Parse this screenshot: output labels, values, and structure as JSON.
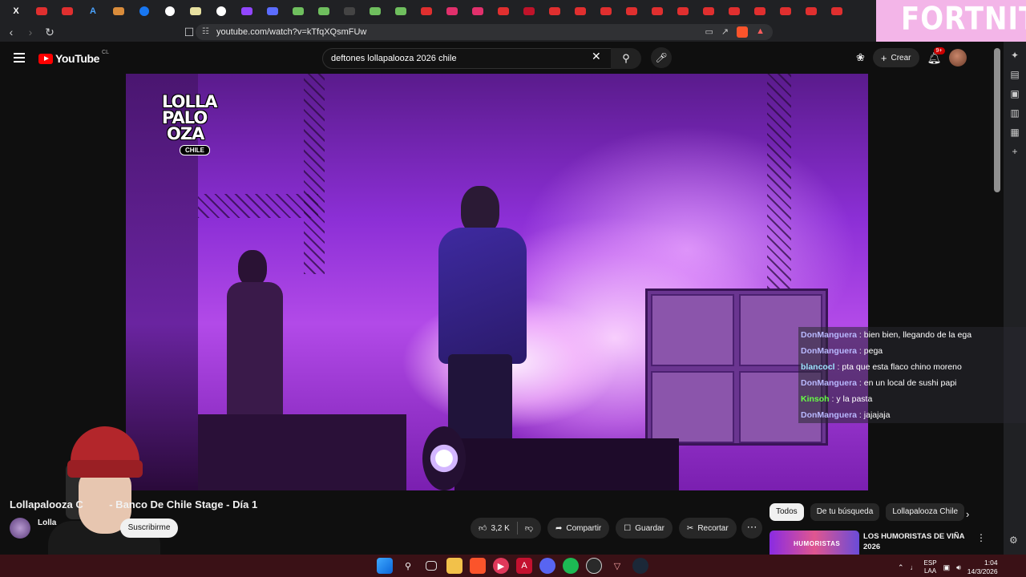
{
  "browser": {
    "url": "youtube.com/watch?v=kTfqXQsmFUw",
    "active_tab_banner": "FORTNITE"
  },
  "youtube": {
    "logo_text": "YouTube",
    "region": "CL",
    "search_query": "deftones lollapalooza 2026 chile",
    "create_label": "Crear",
    "notifications_badge": "9+"
  },
  "video": {
    "logo_lines": [
      "LOLLA",
      "PALO",
      "OZA"
    ],
    "logo_chile": "CHILE",
    "title": "Lollapalooza Chile 2026 - Banco De Chile Stage - Día 1",
    "title_visible": "Lollapalooza C         - Banco De Chile Stage - Día 1",
    "channel": "Lollapalooza Chile",
    "channel_visible": "Lolla",
    "subscribe_label": "Suscribirme",
    "likes": "3,2 K",
    "share_label": "Compartir",
    "save_label": "Guardar",
    "clip_label": "Recortar"
  },
  "chat": [
    {
      "user": "DonManguera",
      "message": "bien bien, llegando de la ega",
      "color": "#b9b9ff"
    },
    {
      "user": "DonManguera",
      "message": "pega",
      "color": "#b9b9ff"
    },
    {
      "user": "blancocl",
      "message": "pta que esta flaco chino moreno",
      "color": "#9fe6ff"
    },
    {
      "user": "DonManguera",
      "message": "en un local de sushi papi",
      "color": "#b9b9ff"
    },
    {
      "user": "Kinsoh",
      "message": "y la pasta",
      "color": "#66ff44"
    },
    {
      "user": "DonManguera",
      "message": "jajajaja",
      "color": "#b9b9ff"
    }
  ],
  "filters": {
    "chips": [
      "Todos",
      "De tu búsqueda",
      "Lollapalooza Chile"
    ],
    "selected": "Todos"
  },
  "recommendation": {
    "title": "LOS HUMORISTAS DE VIÑA 2026",
    "thumb_text": "HUMORISTAS"
  },
  "taskbar": {
    "language_line1": "ESP",
    "language_line2": "LAA",
    "time": "1:04",
    "date": "14/3/2026"
  },
  "colors": {
    "youtube_red": "#ff0000",
    "taskbar_bg": "#3a1116",
    "stage_purple": "#b24ae8"
  }
}
